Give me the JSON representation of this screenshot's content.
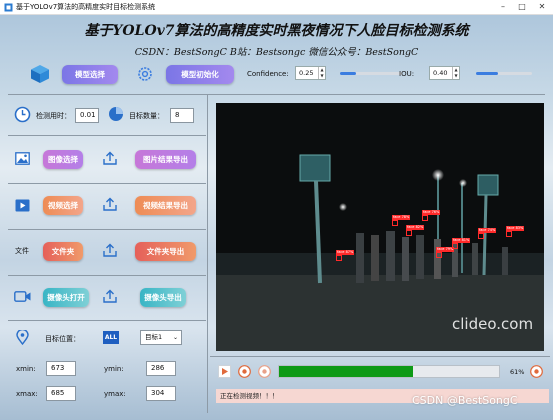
{
  "window": {
    "title": "基于YOLOv7算法的高精度实时目标检测系统"
  },
  "header": {
    "title": "基于YOLOv7算法的高精度实时黑夜情况下人脸目标检测系统",
    "subtitle": "CSDN：BestSongC   B站：Bestsongc   微信公众号：BestSongC"
  },
  "toolbar": {
    "model_select_label": "模型选择",
    "model_init_label": "模型初始化",
    "confidence_label": "Confidence:",
    "confidence_value": "0.25",
    "confidence_level": 0.25,
    "iou_label": "IOU:",
    "iou_value": "0.40",
    "iou_level": 0.4
  },
  "stats": {
    "time_label": "检测用时：",
    "time_value": "0.01",
    "count_label": "目标数量：",
    "count_value": "8"
  },
  "image_section": {
    "select_label": "图像选择",
    "export_label": "图片结果导出"
  },
  "video_section": {
    "select_label": "视频选择",
    "export_label": "视频结果导出"
  },
  "folder_section": {
    "side_label": "文件",
    "open_label": "文件夹",
    "export_label": "文件夹导出"
  },
  "camera_section": {
    "open_label": "摄像头打开",
    "export_label": "摄像头导出"
  },
  "position": {
    "label": "目标位置：",
    "badge": "ALL",
    "selected_target": "目标1",
    "xmin_label": "xmin:",
    "xmin_value": "673",
    "ymin_label": "ymin:",
    "ymin_value": "286",
    "xmax_label": "xmax:",
    "xmax_value": "685",
    "ymax_label": "ymax:",
    "ymax_value": "304"
  },
  "video": {
    "watermark": "clideo.com",
    "detections": [
      {
        "label": "face 87%"
      },
      {
        "label": "face 78%"
      },
      {
        "label": "face 82%"
      },
      {
        "label": "face 76%"
      },
      {
        "label": "face 79%"
      },
      {
        "label": "face 81%"
      },
      {
        "label": "face 74%"
      },
      {
        "label": "face 83%"
      }
    ]
  },
  "playback": {
    "progress": 0.61,
    "progress_text": "61%"
  },
  "status": {
    "text": "正在检测视频！！！"
  },
  "footer": {
    "watermark": "CSDN @BestSongC"
  },
  "colors": {
    "accent": "#3b7de0",
    "progress_fill": "#0e9a16",
    "status_bg": "#f6d7d2",
    "bbox": "#ff2a2a"
  }
}
